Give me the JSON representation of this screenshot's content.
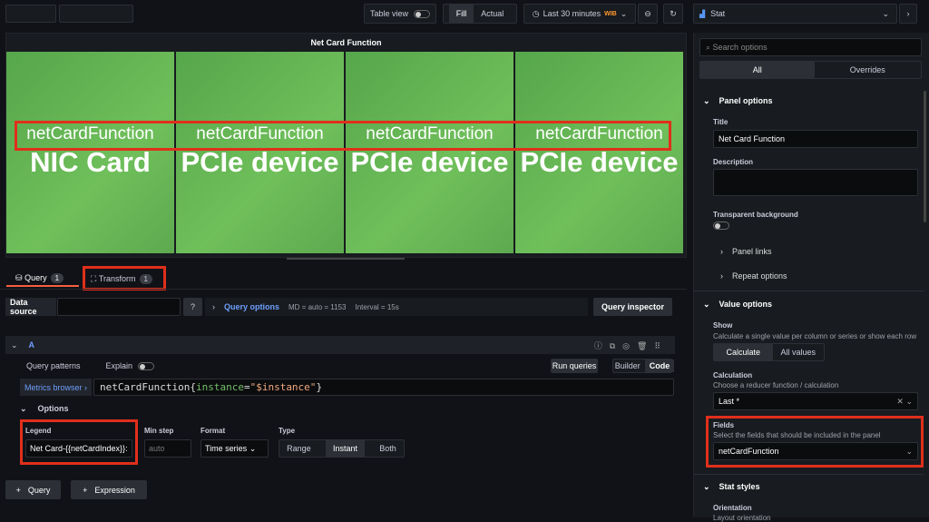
{
  "toolbar": {
    "table_view": "Table view",
    "fill": "Fill",
    "actual": "Actual",
    "time_range": "Last 30 minutes",
    "timezone": "WIB",
    "viz_type": "Stat"
  },
  "panel": {
    "title": "Net Card Function",
    "tiles": [
      {
        "label": "netCardFunction",
        "value": "NIC Card"
      },
      {
        "label": "netCardFunction",
        "value": "PCIe device"
      },
      {
        "label": "netCardFunction",
        "value": "PCIe device"
      },
      {
        "label": "netCardFunction",
        "value": "PCIe device"
      }
    ]
  },
  "tabs": {
    "query": "Query",
    "query_count": "1",
    "transform": "Transform",
    "transform_count": "1"
  },
  "ds": {
    "label": "Data source",
    "query_options": "Query options",
    "md": "MD = auto = 1153",
    "interval": "Interval = 15s",
    "inspector": "Query inspector"
  },
  "query": {
    "ref": "A",
    "patterns": "Query patterns",
    "explain": "Explain",
    "run": "Run queries",
    "builder": "Builder",
    "code": "Code",
    "metrics_browser": "Metrics browser",
    "expr_metric": "netCardFunction",
    "expr_open": "{",
    "expr_key": "instance",
    "expr_eq": "=",
    "expr_val": "\"$instance\"",
    "expr_close": "}",
    "options": "Options",
    "legend_label": "Legend",
    "legend_value": "Net Card-{{netCardIndex}}:",
    "minstep_label": "Min step",
    "minstep_placeholder": "auto",
    "format_label": "Format",
    "format_value": "Time series",
    "type_label": "Type",
    "type_range": "Range",
    "type_instant": "Instant",
    "type_both": "Both"
  },
  "bottom": {
    "add_query": "Query",
    "add_expression": "Expression"
  },
  "options": {
    "search_placeholder": "Search options",
    "tab_all": "All",
    "tab_overrides": "Overrides",
    "panel_options": "Panel options",
    "title_label": "Title",
    "title_value": "Net Card Function",
    "description_label": "Description",
    "transparent_label": "Transparent background",
    "panel_links": "Panel links",
    "repeat_options": "Repeat options",
    "value_options": "Value options",
    "show_label": "Show",
    "show_desc": "Calculate a single value per column or series or show each row",
    "calculate": "Calculate",
    "all_values": "All values",
    "calc_label": "Calculation",
    "calc_desc": "Choose a reducer function / calculation",
    "calc_value": "Last *",
    "fields_label": "Fields",
    "fields_desc": "Select the fields that should be included in the panel",
    "fields_value": "netCardFunction",
    "stat_styles": "Stat styles",
    "orientation_label": "Orientation",
    "orientation_desc": "Layout orientation"
  }
}
